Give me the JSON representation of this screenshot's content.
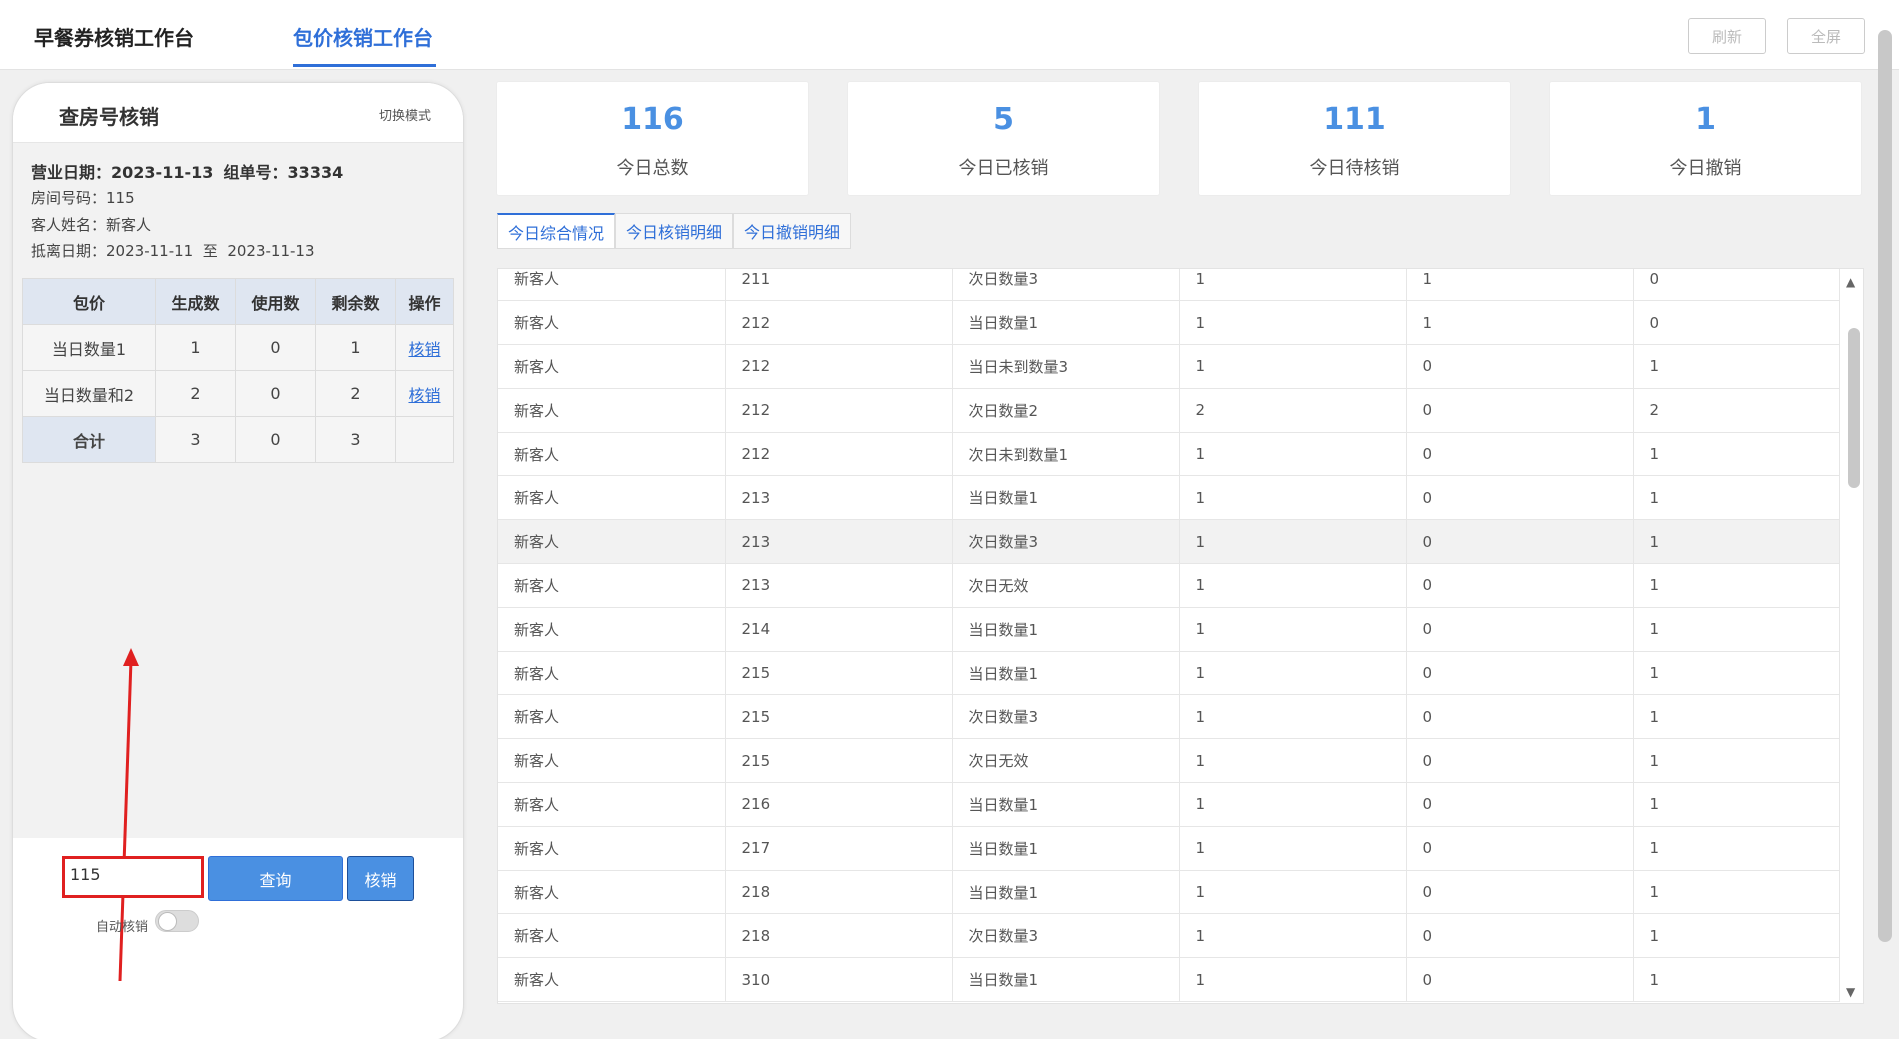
{
  "header": {
    "tabs": [
      {
        "label": "早餐券核销工作台",
        "active": false
      },
      {
        "label": "包价核销工作台",
        "active": true
      }
    ],
    "refresh_label": "刷新",
    "fullscreen_label": "全屏"
  },
  "left_panel": {
    "title": "查房号核销",
    "mode_switch": "切换模式",
    "business_date_label": "营业日期：",
    "business_date": "2023-11-13",
    "group_no_label": "组单号：",
    "group_no": "33334",
    "room_label": "房间号码：",
    "room": "115",
    "guest_label": "客人姓名：",
    "guest": "新客人",
    "stay_label": "抵离日期：",
    "stay_from": "2023-11-11",
    "stay_to_word": "至",
    "stay_to": "2023-11-13",
    "table": {
      "headers": [
        "包价",
        "生成数",
        "使用数",
        "剩余数",
        "操作"
      ],
      "rows": [
        {
          "name": "当日数量1",
          "gen": "1",
          "used": "0",
          "left": "1",
          "action": "核销"
        },
        {
          "name": "当日数量和2",
          "gen": "2",
          "used": "0",
          "left": "2",
          "action": "核销"
        }
      ],
      "total": {
        "name": "合计",
        "gen": "3",
        "used": "0",
        "left": "3"
      }
    },
    "input_value": "115",
    "query_label": "查询",
    "verify_label": "核销",
    "auto_label": "自动核销",
    "auto_on": false
  },
  "stats": [
    {
      "value": "116",
      "label": "今日总数"
    },
    {
      "value": "5",
      "label": "今日已核销"
    },
    {
      "value": "111",
      "label": "今日待核销"
    },
    {
      "value": "1",
      "label": "今日撤销"
    }
  ],
  "detail_tabs": [
    {
      "label": "今日综合情况",
      "active": true
    },
    {
      "label": "今日核销明细",
      "active": false
    },
    {
      "label": "今日撤销明细",
      "active": false
    }
  ],
  "rows": [
    [
      "新客人",
      "211",
      "次日数量3",
      "1",
      "1",
      "0"
    ],
    [
      "新客人",
      "212",
      "当日数量1",
      "1",
      "1",
      "0"
    ],
    [
      "新客人",
      "212",
      "当日未到数量3",
      "1",
      "0",
      "1"
    ],
    [
      "新客人",
      "212",
      "次日数量2",
      "2",
      "0",
      "2"
    ],
    [
      "新客人",
      "212",
      "次日未到数量1",
      "1",
      "0",
      "1"
    ],
    [
      "新客人",
      "213",
      "当日数量1",
      "1",
      "0",
      "1"
    ],
    [
      "新客人",
      "213",
      "次日数量3",
      "1",
      "0",
      "1"
    ],
    [
      "新客人",
      "213",
      "次日无效",
      "1",
      "0",
      "1"
    ],
    [
      "新客人",
      "214",
      "当日数量1",
      "1",
      "0",
      "1"
    ],
    [
      "新客人",
      "215",
      "当日数量1",
      "1",
      "0",
      "1"
    ],
    [
      "新客人",
      "215",
      "次日数量3",
      "1",
      "0",
      "1"
    ],
    [
      "新客人",
      "215",
      "次日无效",
      "1",
      "0",
      "1"
    ],
    [
      "新客人",
      "216",
      "当日数量1",
      "1",
      "0",
      "1"
    ],
    [
      "新客人",
      "217",
      "当日数量1",
      "1",
      "0",
      "1"
    ],
    [
      "新客人",
      "218",
      "当日数量1",
      "1",
      "0",
      "1"
    ],
    [
      "新客人",
      "218",
      "次日数量3",
      "1",
      "0",
      "1"
    ],
    [
      "新客人",
      "310",
      "当日数量1",
      "1",
      "0",
      "1"
    ]
  ],
  "highlighted_row_index": 6
}
